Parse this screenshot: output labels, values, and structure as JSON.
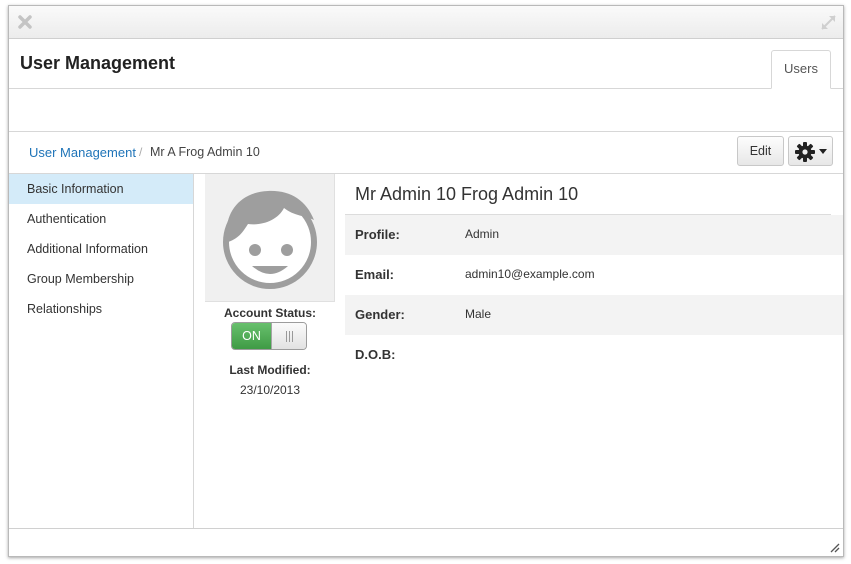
{
  "window": {
    "close_icon": "close-x-icon",
    "expand_icon": "expand-icon"
  },
  "header": {
    "title": "User Management",
    "tabs": [
      {
        "label": "Users"
      }
    ]
  },
  "breadcrumb": {
    "items": [
      "User Management",
      "Mr A Frog Admin 10"
    ],
    "separator": "/"
  },
  "toolbar": {
    "edit_label": "Edit",
    "settings_icon": "gear-icon"
  },
  "sidebar": {
    "items": [
      {
        "label": "Basic Information",
        "active": true
      },
      {
        "label": "Authentication",
        "active": false
      },
      {
        "label": "Additional Information",
        "active": false
      },
      {
        "label": "Group Membership",
        "active": false
      },
      {
        "label": "Relationships",
        "active": false
      }
    ]
  },
  "profile": {
    "account_status_label": "Account Status:",
    "toggle_label": "ON",
    "last_modified_label": "Last Modified:",
    "last_modified_value": "23/10/2013"
  },
  "details": {
    "full_name": "Mr Admin 10 Frog Admin 10",
    "rows": [
      {
        "label": "Profile:",
        "value": "Admin"
      },
      {
        "label": "Email:",
        "value": "admin10@example.com"
      },
      {
        "label": "Gender:",
        "value": "Male"
      },
      {
        "label": "D.O.B:",
        "value": ""
      }
    ]
  },
  "colors": {
    "accent": "#1f74b8",
    "active_bg": "#d4ebf9",
    "toggle_on": "#4caf50"
  }
}
